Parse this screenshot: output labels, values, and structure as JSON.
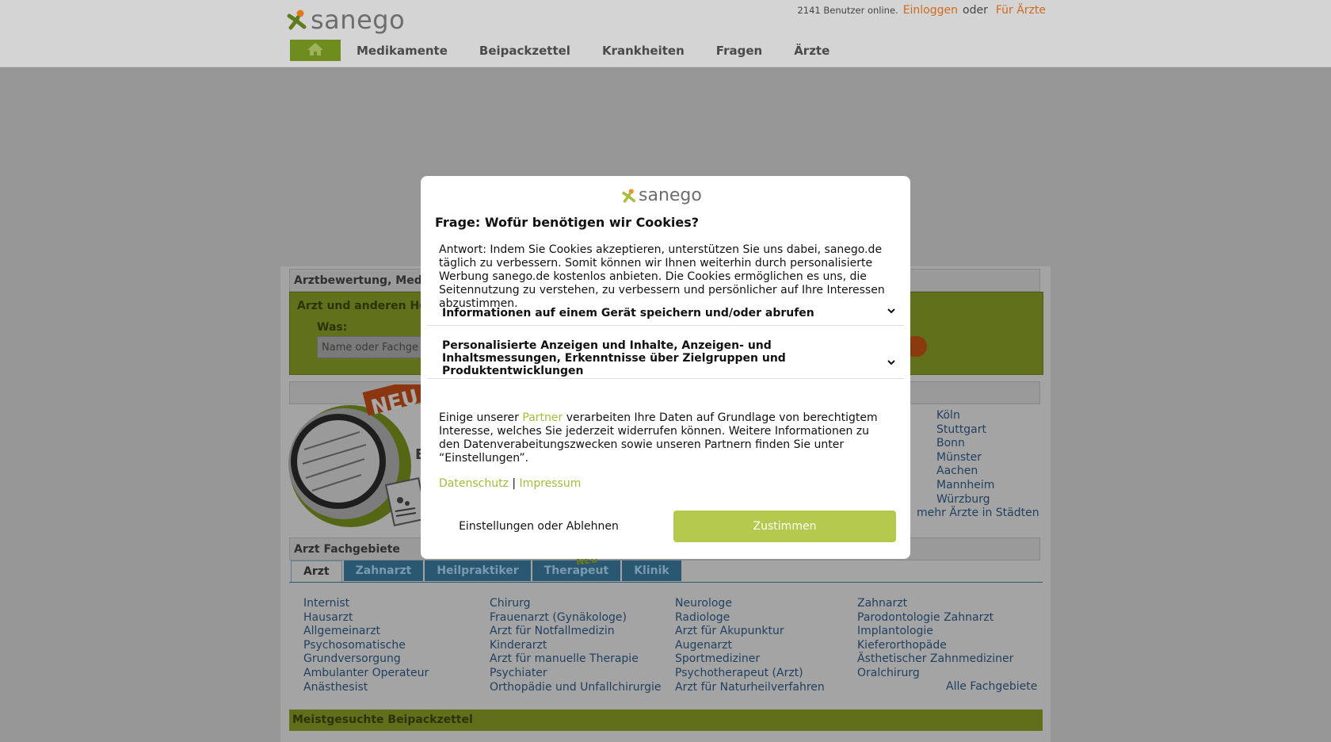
{
  "header": {
    "logo_text": "sanego",
    "users_online": "2141 Benutzer online.",
    "login_label": "Einloggen",
    "or_label": "oder",
    "for_doctors_label": "Für Ärzte",
    "nav": [
      "Medikamente",
      "Beipackzettel",
      "Krankheiten",
      "Fragen",
      "Ärzte"
    ]
  },
  "page": {
    "panel1_title": "Arztbewertung, Medi",
    "search_title": "Arzt und anderen He",
    "search_what_label": "Was:",
    "search_placeholder": "Name oder Fachge",
    "promo_letter": "E",
    "cities": [
      "Köln",
      "Stuttgart",
      "Bonn",
      "Münster",
      "Aachen",
      "Mannheim",
      "Würzburg"
    ],
    "more_cities_label": "mehr Ärzte in Städten",
    "fach_title": "Arzt Fachgebiete",
    "tabs": [
      "Arzt",
      "Zahnarzt",
      "Heilpraktiker",
      "Therapeut",
      "Klinik"
    ],
    "neu_badge": "NEU",
    "fach_col1": [
      "Internist",
      "Hausarzt",
      "Allgemeinarzt",
      "Psychosomatische",
      "Grundversorgung",
      "Ambulanter Operateur",
      "Anästhesist"
    ],
    "fach_col2": [
      "Chirurg",
      "Frauenarzt (Gynäkologe)",
      "Arzt für Notfallmedizin",
      "Kinderarzt",
      "Arzt für manuelle Therapie",
      "Psychiater",
      "Orthopädie und Unfallchirurgie"
    ],
    "fach_col3": [
      "Neurologe",
      "Radiologe",
      "Arzt für Akupunktur",
      "Augenarzt",
      "Sportmediziner",
      "Psychotherapeut (Arzt)",
      "Arzt für Naturheilverfahren"
    ],
    "fach_col4": [
      "Zahnarzt",
      "Parodontologie Zahnarzt",
      "Implantologie",
      "Kieferorthopäde",
      "Ästhetischer Zahnmediziner",
      "Oralchirurg"
    ],
    "all_fach_label": "Alle Fachgebiete",
    "bpz_title": "Meistgesuchte Beipackzettel"
  },
  "modal": {
    "logo_text": "sanego",
    "question": "Frage: Wofür benötigen wir Cookies?",
    "answer": "Antwort: Indem Sie Cookies akzeptieren, unterstützen Sie uns dabei, sanego.de täglich zu verbessern. Somit können wir Ihnen weiterhin durch personalisierte Werbung sanego.de kostenlos anbieten. Die Cookies ermöglichen es uns, die Seitennutzung zu verstehen, zu verbessern und persönlicher auf Ihre Interessen abzustimmen.",
    "accordion1": "Informationen auf einem Gerät speichern und/oder abrufen",
    "accordion2": "Personalisierte Anzeigen und Inhalte, Anzeigen- und Inhaltsmessungen, Erkenntnisse über Zielgruppen und Produktentwicklungen",
    "partner_pre": "Einige unserer",
    "partner_link": "Partner",
    "partner_post": "verarbeiten Ihre Daten auf Grundlage von berechtigtem Interesse, welches Sie jederzeit widerrufen können. Weitere Informationen zu den Datenverabeitungszwecken sowie unseren Partnern finden Sie unter “Einstellungen”.",
    "privacy_label": "Datenschutz",
    "sep": "|",
    "imprint_label": "Impressum",
    "deny_label": "Einstellungen oder Ablehnen",
    "accept_label": "Zustimmen"
  },
  "colors": {
    "accent_green": "#b4c94d",
    "link_orange": "#d06a1c",
    "tab_blue": "#2a5772"
  }
}
